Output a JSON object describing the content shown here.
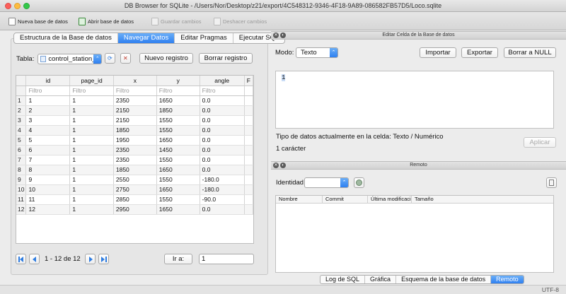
{
  "window": {
    "title": "DB Browser for SQLite - /Users/Nor/Desktop/z21/export/4C548312-9346-4F18-9A89-086582FB57D5/Loco.sqlite"
  },
  "toolbar": {
    "new_db": "Nueva base de datos",
    "open_db": "Abrir base de datos",
    "save": "Guardar cambios",
    "undo": "Deshacer cambios"
  },
  "tabs": [
    {
      "label": "Estructura de la Base de datos"
    },
    {
      "label": "Navegar Datos"
    },
    {
      "label": "Editar Pragmas"
    },
    {
      "label": "Ejecutar SQL"
    }
  ],
  "browse": {
    "table_label": "Tabla:",
    "table_value": "control_station_",
    "new_record": "Nuevo registro",
    "delete_record": "Borrar registro",
    "columns": [
      "id",
      "page_id",
      "x",
      "y",
      "angle"
    ],
    "filter_placeholder": "Filtro",
    "rows": [
      [
        "1",
        "1",
        "1",
        "2350",
        "1650",
        "0.0"
      ],
      [
        "2",
        "2",
        "1",
        "2150",
        "1850",
        "0.0"
      ],
      [
        "3",
        "3",
        "1",
        "2150",
        "1550",
        "0.0"
      ],
      [
        "4",
        "4",
        "1",
        "1850",
        "1550",
        "0.0"
      ],
      [
        "5",
        "5",
        "1",
        "1950",
        "1650",
        "0.0"
      ],
      [
        "6",
        "6",
        "1",
        "2350",
        "1450",
        "0.0"
      ],
      [
        "7",
        "7",
        "1",
        "2350",
        "1550",
        "0.0"
      ],
      [
        "8",
        "8",
        "1",
        "1850",
        "1650",
        "0.0"
      ],
      [
        "9",
        "9",
        "1",
        "2550",
        "1550",
        "-180.0"
      ],
      [
        "10",
        "10",
        "1",
        "2750",
        "1650",
        "-180.0"
      ],
      [
        "11",
        "11",
        "1",
        "2850",
        "1550",
        "-90.0"
      ],
      [
        "12",
        "12",
        "1",
        "2950",
        "1650",
        "0.0"
      ]
    ],
    "page_info": "1 - 12 de 12",
    "goto_label": "Ir a:",
    "goto_value": "1"
  },
  "cell_editor": {
    "title": "Editar Celda de la Base de datos",
    "mode_label": "Modo:",
    "mode_value": "Texto",
    "import": "Importar",
    "export": "Exportar",
    "set_null": "Borrar a NULL",
    "content": "1",
    "type_info": "Tipo de datos actualmente en la celda: Texto / Numérico",
    "size_info": "1 carácter",
    "apply": "Aplicar"
  },
  "remote": {
    "title": "Remoto",
    "identity_label": "Identidad",
    "columns": [
      "Nombre",
      "Commit",
      "Última modificación",
      "Tamaño"
    ]
  },
  "bottom_tabs": [
    {
      "label": "Log de SQL"
    },
    {
      "label": "Gráfica"
    },
    {
      "label": "Esquema de la base de datos"
    },
    {
      "label": "Remoto"
    }
  ],
  "status": {
    "encoding": "UTF-8"
  },
  "colors": {
    "accent": "#2f80f0",
    "nav_blue": "#2f7de1"
  }
}
